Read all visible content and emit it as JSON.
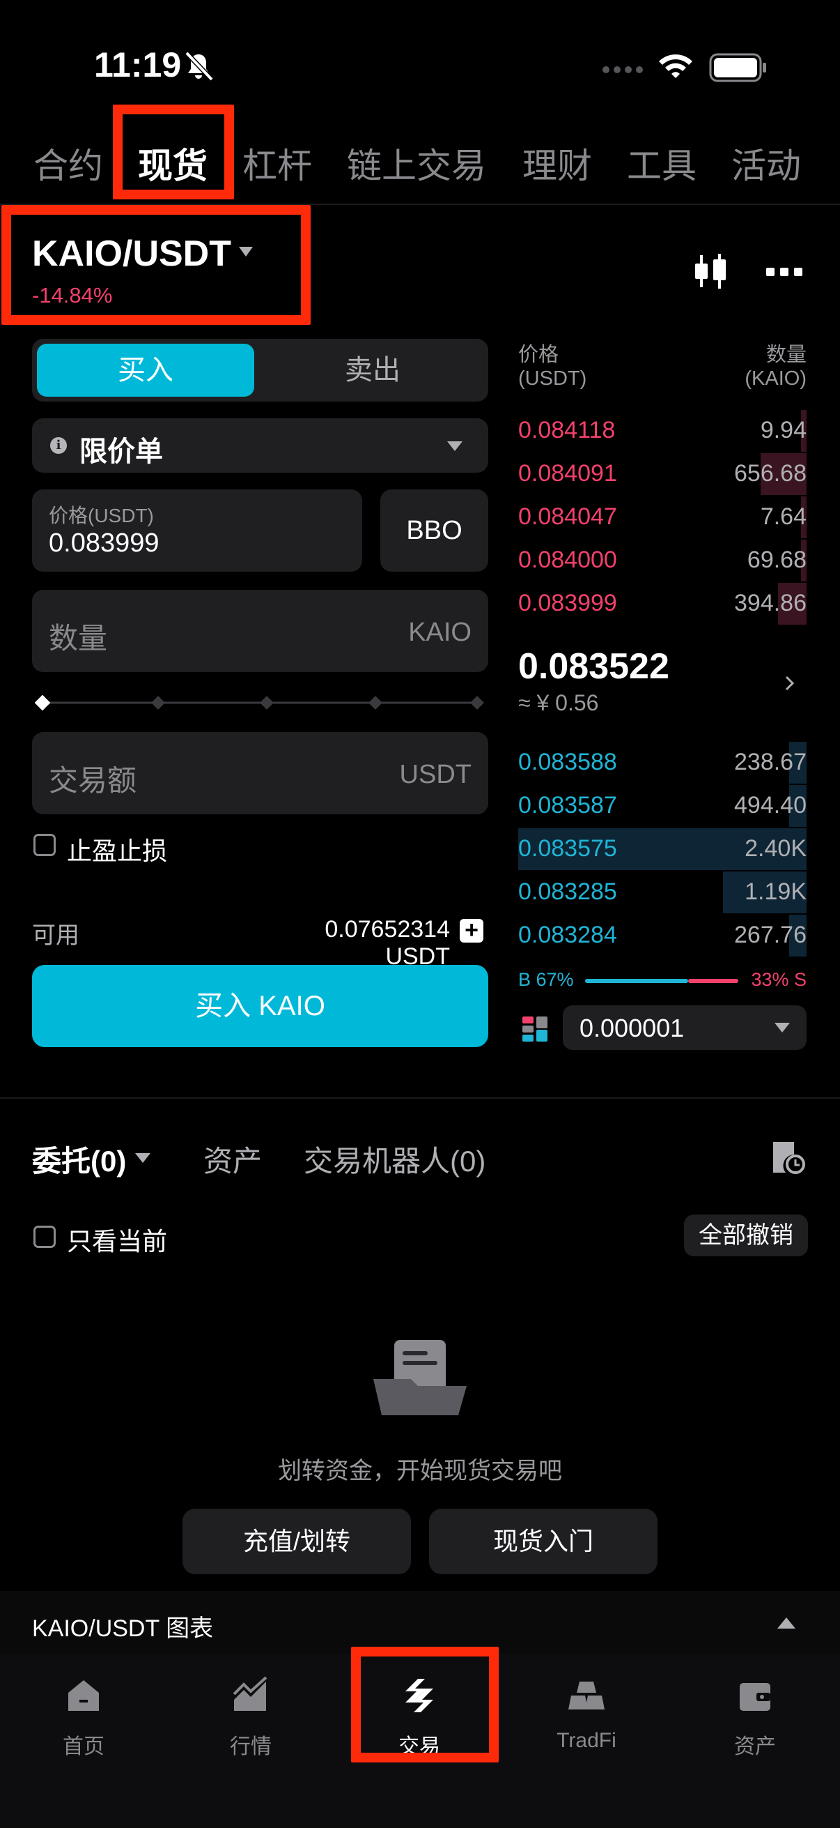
{
  "status_bar": {
    "time": "11:19"
  },
  "top_nav": {
    "items": [
      "合约",
      "现货",
      "杠杆",
      "链上交易",
      "理财",
      "工具",
      "活动"
    ],
    "active": "现货"
  },
  "pair": {
    "symbol": "KAIO/USDT",
    "change": "-14.84%"
  },
  "trade_form": {
    "buy_label": "买入",
    "sell_label": "卖出",
    "order_type": "限价单",
    "price_label": "价格(USDT)",
    "price_value": "0.083999",
    "bbo_label": "BBO",
    "quantity_placeholder": "数量",
    "quantity_unit": "KAIO",
    "slider_value": 0,
    "amount_placeholder": "交易额",
    "amount_unit": "USDT",
    "tpsl_label": "止盈止损",
    "available_label": "可用",
    "available_value": "0.07652314 USDT",
    "submit_label": "买入 KAIO"
  },
  "order_book": {
    "price_header": "价格",
    "price_unit": "(USDT)",
    "qty_header": "数量",
    "qty_unit": "(KAIO)",
    "asks": [
      {
        "price": "0.084118",
        "qty": "9.94",
        "depth": 0.02
      },
      {
        "price": "0.084091",
        "qty": "656.68",
        "depth": 0.16
      },
      {
        "price": "0.084047",
        "qty": "7.64",
        "depth": 0.02
      },
      {
        "price": "0.084000",
        "qty": "69.68",
        "depth": 0.02
      },
      {
        "price": "0.083999",
        "qty": "394.86",
        "depth": 0.1
      }
    ],
    "last_price": "0.083522",
    "last_price_cny": "≈ ¥ 0.56",
    "bids": [
      {
        "price": "0.083588",
        "qty": "238.67",
        "depth": 0.06
      },
      {
        "price": "0.083587",
        "qty": "494.40",
        "depth": 0.06
      },
      {
        "price": "0.083575",
        "qty": "2.40K",
        "depth": 1.0
      },
      {
        "price": "0.083285",
        "qty": "1.19K",
        "depth": 0.29
      },
      {
        "price": "0.083284",
        "qty": "267.76",
        "depth": 0.06
      }
    ],
    "buy_ratio": "B 67%",
    "sell_ratio": "33% S",
    "precision": "0.000001"
  },
  "orders_section": {
    "tabs": [
      "委托(0)",
      "资产",
      "交易机器人(0)"
    ],
    "only_current_label": "只看当前",
    "cancel_all_label": "全部撤销",
    "empty_text": "划转资金，开始现货交易吧",
    "deposit_button": "充值/划转",
    "guide_button": "现货入门"
  },
  "chart_bar": {
    "title": "KAIO/USDT  图表"
  },
  "tab_bar": {
    "items": [
      {
        "label": "首页",
        "icon": "home-icon"
      },
      {
        "label": "行情",
        "icon": "market-icon"
      },
      {
        "label": "交易",
        "icon": "trade-icon"
      },
      {
        "label": "TradFi",
        "icon": "tradfi-icon"
      },
      {
        "label": "资产",
        "icon": "wallet-icon"
      }
    ],
    "active": "交易"
  },
  "colors": {
    "accent": "#00b8d8",
    "ask": "#f2416b",
    "bid": "#1fb5d6",
    "highlight_box": "#ff2a0a"
  }
}
